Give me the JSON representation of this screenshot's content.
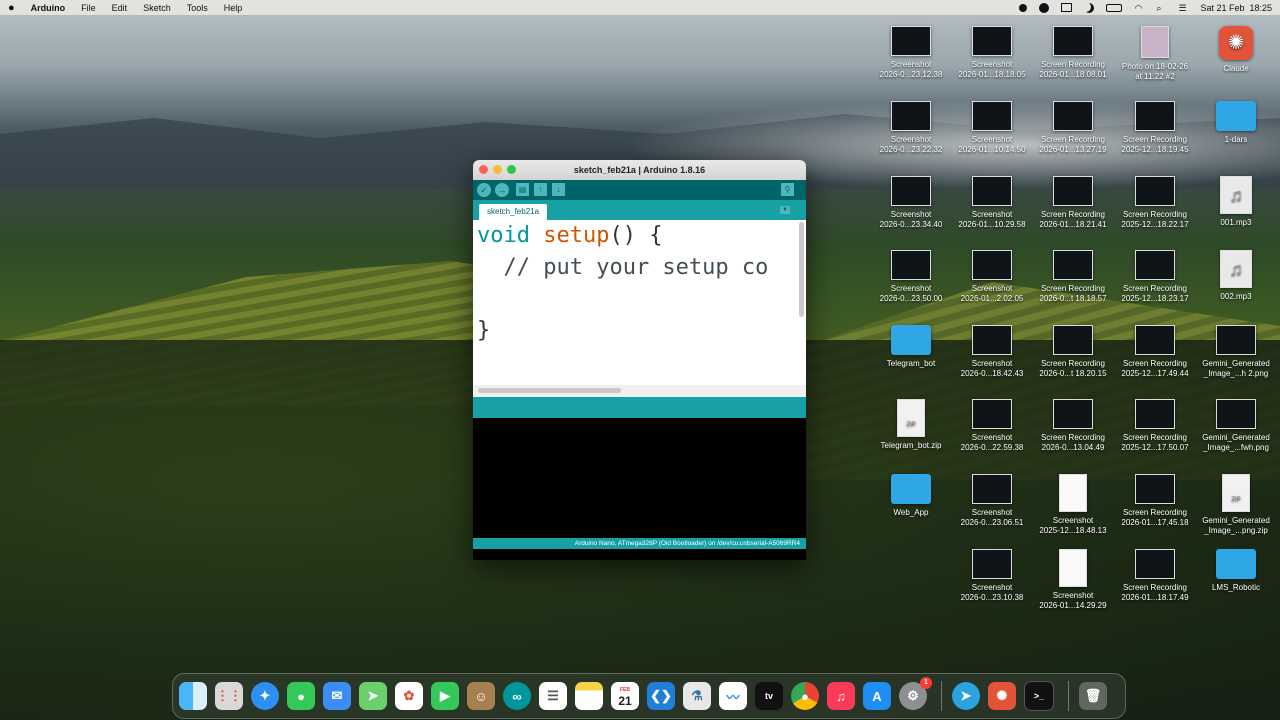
{
  "menubar": {
    "apple": "",
    "app_name": "Arduino",
    "menus": [
      "File",
      "Edit",
      "Sketch",
      "Tools",
      "Help"
    ],
    "clock": "Sat 21 Feb  18:25",
    "status_icons": [
      "record-icon",
      "telegram-icon",
      "screen-mirror-icon",
      "moon-icon",
      "battery-icon",
      "wifi-icon",
      "search-icon",
      "control-center-icon"
    ]
  },
  "window": {
    "title": "sketch_feb21a | Arduino 1.8.16",
    "toolbar": {
      "verify": "✓",
      "upload": "→",
      "new": "▤",
      "open": "↑",
      "save": "↓",
      "serial_monitor": "⚲"
    },
    "tab_label": "sketch_feb21a",
    "tab_menu": "▼",
    "code": {
      "l1_kw": "void",
      "l1_fn": "setup",
      "l1_rest": "() {",
      "l2": "  // put your setup co",
      "l4": "}"
    },
    "status": "Arduino Nano, ATmega328P (Old Bootloader) on /dev/cu.usbserial-A5069RR4"
  },
  "desktop": {
    "icons": [
      {
        "l1": "Screenshot",
        "l2": "2026-0...23.12.38"
      },
      {
        "l1": "Screenshot",
        "l2": "2026-01...18.18.05"
      },
      {
        "l1": "Screen Recording",
        "l2": "2026-01...18.08.01"
      },
      {
        "l1": "Photo on 18-02-26",
        "l2": "at 11.22 #2"
      },
      {
        "l1": "Claude",
        "l2": ""
      },
      {
        "l1": "Screenshot",
        "l2": "2026-0...23.22.32"
      },
      {
        "l1": "Screenshot",
        "l2": "2026-01...10.14.50"
      },
      {
        "l1": "Screen Recording",
        "l2": "2026-01...13.27.19"
      },
      {
        "l1": "Screen Recording",
        "l2": "2025-12...18.19.45"
      },
      {
        "l1": "1-dars",
        "l2": ""
      },
      {
        "l1": "Screenshot",
        "l2": "2026-0...23.34.40"
      },
      {
        "l1": "Screenshot",
        "l2": "2026-01...10.29.58"
      },
      {
        "l1": "Screen Recording",
        "l2": "2026-01...18.21.41"
      },
      {
        "l1": "Screen Recording",
        "l2": "2025-12...18.22.17"
      },
      {
        "l1": "001.mp3",
        "l2": ""
      },
      {
        "l1": "Screenshot",
        "l2": "2026-0...23.50.00"
      },
      {
        "l1": "Screenshot",
        "l2": "2026-01...2.02.05"
      },
      {
        "l1": "Screen Recording",
        "l2": "2026-0...t 18.18.57"
      },
      {
        "l1": "Screen Recording",
        "l2": "2025-12...18.23.17"
      },
      {
        "l1": "002.mp3",
        "l2": ""
      },
      {
        "l1": "Telegram_bot",
        "l2": ""
      },
      {
        "l1": "Screenshot",
        "l2": "2026-0...18.42.43"
      },
      {
        "l1": "Screen Recording",
        "l2": "2026-0...t 18.20.15"
      },
      {
        "l1": "Screen Recording",
        "l2": "2025-12...17.49.44"
      },
      {
        "l1": "Gemini_Generated",
        "l2": "_Image_...h 2.png"
      },
      {
        "l1": "Telegram_bot.zip",
        "l2": ""
      },
      {
        "l1": "Screenshot",
        "l2": "2026-0...22.59.38"
      },
      {
        "l1": "Screen Recording",
        "l2": "2026-0...13.04.49"
      },
      {
        "l1": "Screen Recording",
        "l2": "2025-12...17.50.07"
      },
      {
        "l1": "Gemini_Generated",
        "l2": "_Image_...fwh.png"
      },
      {
        "l1": "Web_App",
        "l2": ""
      },
      {
        "l1": "Screenshot",
        "l2": "2026-0...23.06.51"
      },
      {
        "l1": "Screenshot",
        "l2": "2025-12...18.48.13"
      },
      {
        "l1": "Screen Recording",
        "l2": "2026-01...17.45.18"
      },
      {
        "l1": "Gemini_Generated",
        "l2": "_Image_...png.zip"
      },
      {
        "l1": "Screenshot",
        "l2": "2026-0...23.10.38"
      },
      {
        "l1": "Screenshot",
        "l2": "2026-01...14.29.29"
      },
      {
        "l1": "Screen Recording",
        "l2": "2026-01...18.17.49"
      },
      {
        "l1": "LMS_Robotic",
        "l2": ""
      }
    ]
  },
  "dock": {
    "calendar_month": "FEB",
    "calendar_day": "21",
    "settings_badge": "1",
    "appletv": "tv"
  }
}
